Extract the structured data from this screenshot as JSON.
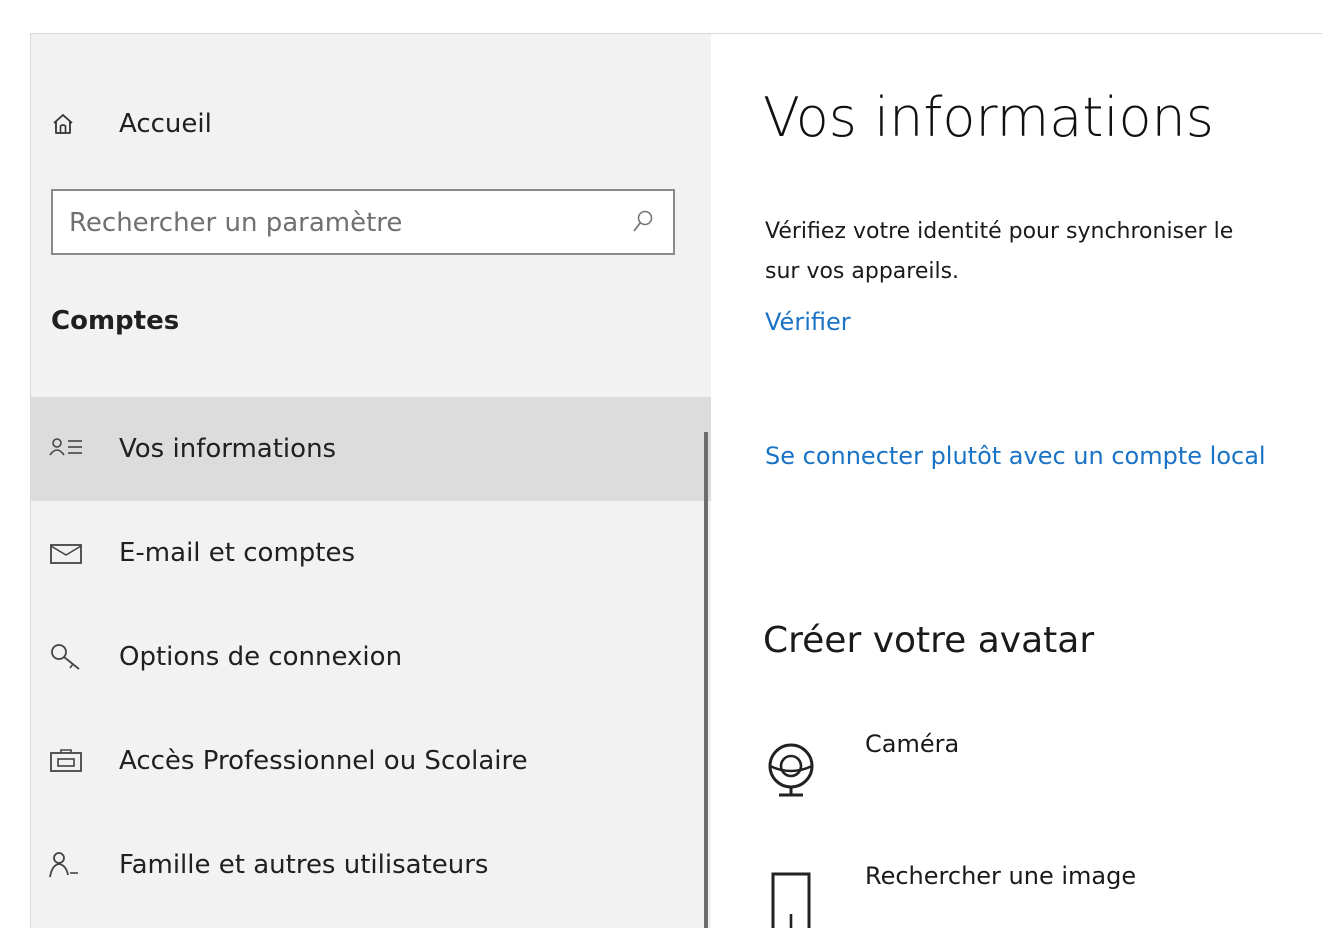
{
  "sidebar": {
    "home_label": "Accueil",
    "search_placeholder": "Rechercher un paramètre",
    "section_title": "Comptes",
    "items": [
      {
        "label": "Vos informations",
        "icon": "person-info-icon",
        "active": true
      },
      {
        "label": "E-mail et comptes",
        "icon": "mail-icon",
        "active": false
      },
      {
        "label": "Options de connexion",
        "icon": "key-icon",
        "active": false
      },
      {
        "label": "Accès Professionnel ou Scolaire",
        "icon": "briefcase-icon",
        "active": false
      },
      {
        "label": "Famille et autres utilisateurs",
        "icon": "person-add-icon",
        "active": false
      }
    ]
  },
  "main": {
    "title": "Vos informations",
    "description_line1": "Vérifiez votre identité pour synchroniser le",
    "description_line2": "sur vos appareils.",
    "verify_link": "Vérifier",
    "local_account_link": "Se connecter plutôt avec un compte local",
    "avatar_heading": "Créer votre avatar",
    "avatar_options": [
      {
        "label": "Caméra",
        "icon": "webcam-icon"
      },
      {
        "label": "Rechercher une image",
        "icon": "browse-image-icon"
      }
    ]
  },
  "colors": {
    "accent_link": "#1a73c4",
    "sidebar_bg": "#f2f2f2",
    "active_item_bg": "#dcdcdc"
  }
}
